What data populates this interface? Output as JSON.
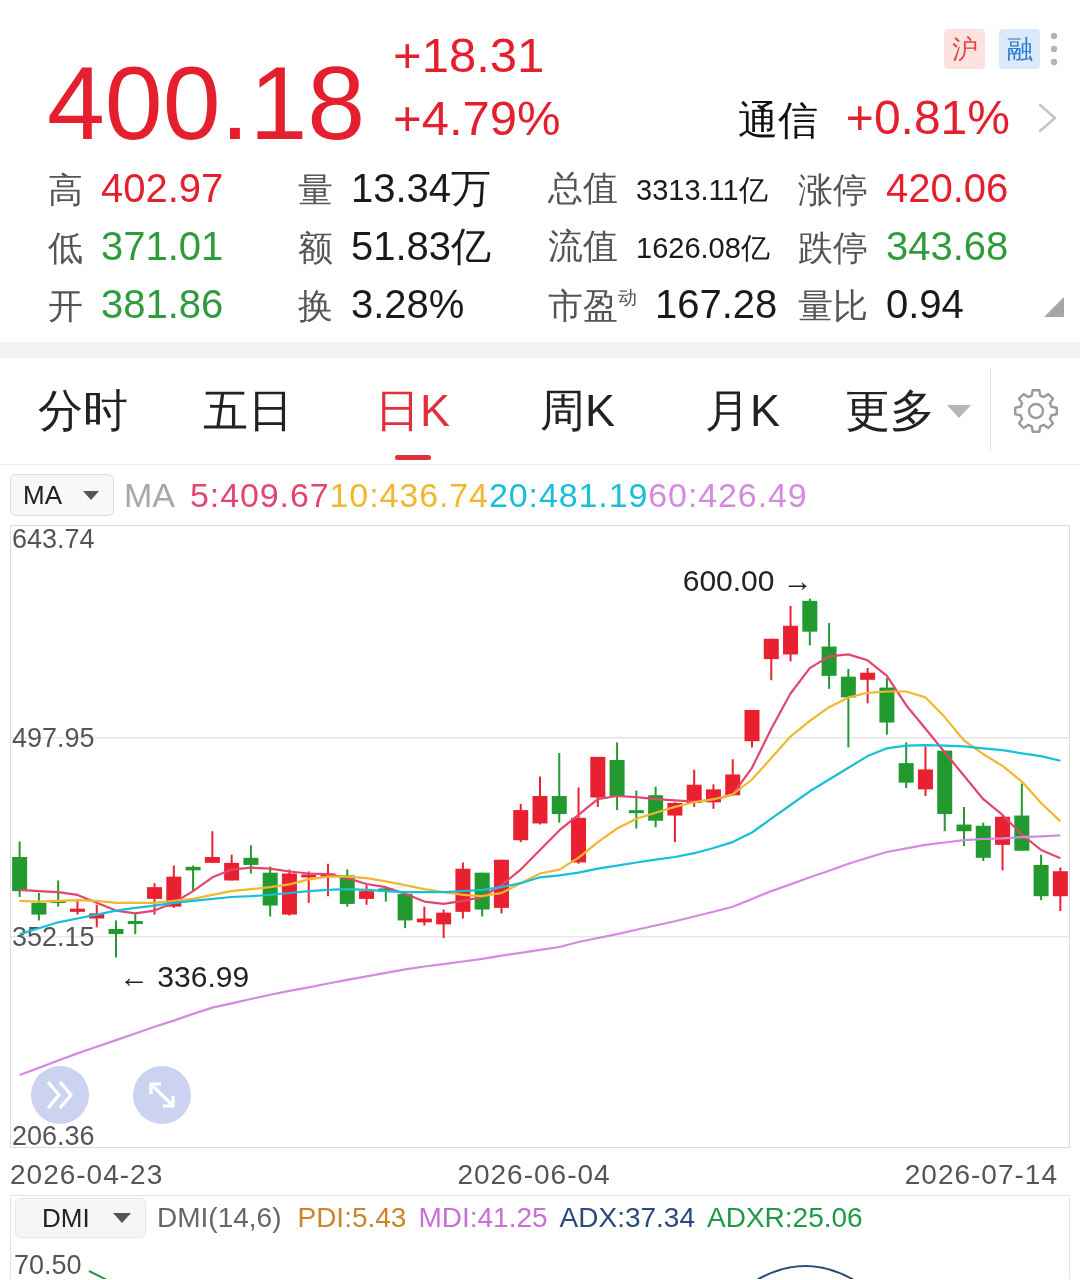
{
  "quote": {
    "price": "400.18",
    "change": "+18.31",
    "change_percent": "+4.79%",
    "color": "#e5202e"
  },
  "tags": [
    {
      "text": "沪",
      "kind": "exchange"
    },
    {
      "text": "融",
      "kind": "margin"
    }
  ],
  "sector": {
    "name": "通信",
    "change": "+0.81%",
    "color": "#e5202e"
  },
  "stats": [
    {
      "label": "高",
      "value": "402.97",
      "color": "#e5202e"
    },
    {
      "label": "量",
      "value": "13.34万",
      "color": "#1a1a1a"
    },
    {
      "label": "总值",
      "value": "3313.11亿",
      "color": "#1a1a1a"
    },
    {
      "label": "涨停",
      "value": "420.06",
      "color": "#e5202e"
    },
    {
      "label": "低",
      "value": "371.01",
      "color": "#2e9b3c"
    },
    {
      "label": "额",
      "value": "51.83亿",
      "color": "#1a1a1a"
    },
    {
      "label": "流值",
      "value": "1626.08亿",
      "color": "#1a1a1a"
    },
    {
      "label": "跌停",
      "value": "343.68",
      "color": "#2e9b3c"
    },
    {
      "label": "开",
      "value": "381.86",
      "color": "#2e9b3c"
    },
    {
      "label": "换",
      "value": "3.28%",
      "color": "#1a1a1a"
    },
    {
      "label": "市盈$^{动}$",
      "value": "167.28",
      "color": "#1a1a1a"
    },
    {
      "label": "量比",
      "value": "0.94",
      "color": "#1a1a1a"
    }
  ],
  "tabs": [
    {
      "label": "分时",
      "kind": "period",
      "selected": false
    },
    {
      "label": "五日",
      "kind": "period",
      "selected": false
    },
    {
      "label": "日K",
      "kind": "period",
      "selected": true
    },
    {
      "label": "周K",
      "kind": "period",
      "selected": false
    },
    {
      "label": "月K",
      "kind": "period",
      "selected": false
    },
    {
      "label": "更多",
      "kind": "menu",
      "selected": false
    }
  ],
  "indicator_bar": {
    "selector": "MA",
    "name": "MA",
    "values": [
      {
        "text": "5:409.67",
        "color": "#e2466e"
      },
      {
        "text": "10:436.74",
        "color": "#f0b72f"
      },
      {
        "text": "20:481.19",
        "color": "#17bfd8"
      },
      {
        "text": "60:426.49",
        "color": "#d48ae0"
      }
    ]
  },
  "price_chart": {
    "chart_data": {
      "type": "candlestick",
      "categories": [
        null,
        null,
        null,
        null,
        null,
        null,
        null,
        null,
        null,
        null,
        null,
        null,
        null,
        null,
        null,
        null,
        null,
        null,
        null,
        null,
        null,
        null,
        null,
        null,
        null,
        null,
        null,
        null,
        null,
        null,
        null,
        null,
        null,
        null,
        null,
        null,
        null,
        null,
        null,
        null,
        null,
        null,
        null,
        null,
        null,
        null,
        null,
        null,
        null,
        null,
        null,
        null,
        null,
        null,
        null
      ],
      "ylim": [
        198.0,
        654.0
      ],
      "yticks": [
        {
          "value": 352.15,
          "label": "352.15"
        },
        {
          "value": 206.36,
          "label": "206.36"
        }
      ],
      "ohlc": [
        [
          410.6,
          422.0,
          381.3,
          385.6
        ],
        [
          377.0,
          384.2,
          364.1,
          368.4
        ],
        [
          379.0,
          393.4,
          374.2,
          377.0
        ],
        [
          370.4,
          379.9,
          368.4,
          372.7
        ],
        [
          365.5,
          375.6,
          359.0,
          369.3
        ],
        [
          357.8,
          364.1,
          336.99,
          354.1
        ],
        [
          363.3,
          369.8,
          354.1,
          361.8
        ],
        [
          379.9,
          391.4,
          368.4,
          388.5
        ],
        [
          374.2,
          404.3,
          373.3,
          396.2
        ],
        [
          403.4,
          404.3,
          385.6,
          400.8
        ],
        [
          406.3,
          429.5,
          406.3,
          410.6
        ],
        [
          393.4,
          412.3,
          393.4,
          406.3
        ],
        [
          410.0,
          419.2,
          398.5,
          404.8
        ],
        [
          399.1,
          403.7,
          367.0,
          375.0
        ],
        [
          368.4,
          401.4,
          367.6,
          398.5
        ],
        [
          395.7,
          400.0,
          377.0,
          397.7
        ],
        [
          396.2,
          405.7,
          381.9,
          398.5
        ],
        [
          397.1,
          401.4,
          374.2,
          376.2
        ],
        [
          379.9,
          389.9,
          375.6,
          385.6
        ],
        [
          387.1,
          388.5,
          377.9,
          385.9
        ],
        [
          383.6,
          384.2,
          358.4,
          364.1
        ],
        [
          362.7,
          374.2,
          360.4,
          365.5
        ],
        [
          361.2,
          372.1,
          351.2,
          369.8
        ],
        [
          370.4,
          406.6,
          365.5,
          402.0
        ],
        [
          399.1,
          399.1,
          367.0,
          372.1
        ],
        [
          373.3,
          408.6,
          369.3,
          408.6
        ],
        [
          422.9,
          449.6,
          421.5,
          445.0
        ],
        [
          435.2,
          469.7,
          434.4,
          455.3
        ],
        [
          455.3,
          486.9,
          435.8,
          442.1
        ],
        [
          406.6,
          461.6,
          405.7,
          439.3
        ],
        [
          454.2,
          484.0,
          447.3,
          484.0
        ],
        [
          481.7,
          494.6,
          445.0,
          455.3
        ],
        [
          444.4,
          459.3,
          431.5,
          443.3
        ],
        [
          455.9,
          462.2,
          432.4,
          437.2
        ],
        [
          441.0,
          450.7,
          421.5,
          450.2
        ],
        [
          450.2,
          474.5,
          447.3,
          463.6
        ],
        [
          450.7,
          463.9,
          445.9,
          460.2
        ],
        [
          455.9,
          482.3,
          455.3,
          471.1
        ],
        [
          495.5,
          518.4,
          490.9,
          518.4
        ],
        [
          555.7,
          570.6,
          540.2,
          570.6
        ],
        [
          559.1,
          594.7,
          554.0,
          580.1
        ],
        [
          598.4,
          600.0,
          565.7,
          575.8
        ],
        [
          564.9,
          582.1,
          533.9,
          543.4
        ],
        [
          542.8,
          548.5,
          490.9,
          527.6
        ],
        [
          540.5,
          549.1,
          523.3,
          545.7
        ],
        [
          534.8,
          541.9,
          500.3,
          509.2
        ],
        [
          479.4,
          494.6,
          461.1,
          465.1
        ],
        [
          460.2,
          491.7,
          455.3,
          474.8
        ],
        [
          488.6,
          488.6,
          429.5,
          442.1
        ],
        [
          434.4,
          447.3,
          418.6,
          429.5
        ],
        [
          433.5,
          435.8,
          407.7,
          410.0
        ],
        [
          419.5,
          441.0,
          400.8,
          440.1
        ],
        [
          441.0,
          464.5,
          415.2,
          415.2
        ],
        [
          404.8,
          412.3,
          379.0,
          381.87
        ],
        [
          381.86,
          402.97,
          371.01,
          400.18
        ]
      ],
      "annotations": [
        "600.00 →",
        "← 336.99"
      ]
    },
    "date_labels": [
      "2026-04-23",
      "2026-06-04",
      "2026-07-14"
    ]
  },
  "moving_averages": {
    "chart_data": {
      "type": "line",
      "categories": [
        null,
        null,
        null,
        null,
        null,
        null,
        null,
        null,
        null,
        null,
        null,
        null,
        null,
        null,
        null,
        null,
        null,
        null,
        null,
        null,
        null,
        null,
        null,
        null,
        null,
        null,
        null,
        null,
        null,
        null,
        null,
        null,
        null,
        null,
        null,
        null,
        null,
        null,
        null,
        null,
        null,
        null,
        null,
        null,
        null,
        null,
        null,
        null,
        null,
        null,
        null,
        null,
        null,
        null,
        null
      ],
      "ylim": [
        198.0,
        654.0
      ],
      "yticks": [
        {
          "value": 643.74,
          "label": "643.74"
        },
        {
          "value": 497.95,
          "label": "497.95"
        }
      ],
      "series": [
        {
          "color": "#e2466e",
          "values": [
            386.5,
            385.6,
            384.8,
            382.8,
            377.0,
            371.3,
            369.3,
            371.3,
            377.0,
            385.6,
            395.7,
            401.4,
            402.8,
            402.0,
            400.0,
            398.5,
            398.0,
            395.1,
            390.8,
            388.5,
            383.6,
            377.9,
            376.2,
            378.5,
            381.3,
            389.9,
            401.4,
            415.7,
            430.1,
            441.5,
            453.0,
            455.3,
            454.5,
            453.0,
            452.2,
            451.3,
            452.4,
            456.5,
            476.0,
            504.6,
            530.5,
            549.1,
            557.7,
            559.1,
            554.8,
            543.4,
            521.9,
            504.6,
            487.4,
            470.2,
            453.0,
            441.5,
            427.2,
            415.7,
            409.67
          ]
        },
        {
          "color": "#f0b72f",
          "values": [
            378.5,
            377.9,
            378.5,
            379.0,
            378.5,
            377.0,
            377.0,
            377.0,
            378.5,
            379.9,
            382.8,
            385.6,
            387.1,
            388.5,
            390.5,
            394.2,
            396.2,
            396.2,
            395.1,
            392.8,
            389.9,
            387.1,
            384.8,
            382.8,
            381.9,
            384.2,
            391.4,
            398.5,
            401.4,
            410.0,
            421.5,
            431.5,
            438.7,
            443.0,
            447.3,
            450.7,
            453.0,
            456.5,
            467.4,
            483.1,
            498.9,
            510.4,
            520.4,
            527.6,
            531.0,
            531.9,
            531.9,
            527.6,
            513.2,
            496.0,
            486.0,
            477.4,
            465.9,
            450.2,
            436.74
          ]
        },
        {
          "color": "#17bfd8",
          "values": [
            354.1,
            358.4,
            362.7,
            365.5,
            368.4,
            371.3,
            373.3,
            375.0,
            377.0,
            378.5,
            379.9,
            381.3,
            381.9,
            382.8,
            384.2,
            385.6,
            386.5,
            387.1,
            386.5,
            385.6,
            384.8,
            384.8,
            384.8,
            385.6,
            386.5,
            388.5,
            391.4,
            395.7,
            397.1,
            399.1,
            402.0,
            404.3,
            406.6,
            408.6,
            410.6,
            413.4,
            417.2,
            421.5,
            428.6,
            438.7,
            448.7,
            458.8,
            467.4,
            476.0,
            484.6,
            490.3,
            492.3,
            492.6,
            492.3,
            491.7,
            490.3,
            488.9,
            486.6,
            484.6,
            481.19
          ]
        },
        {
          "color": "#d48ae0",
          "values": [
            250.8,
            256.0,
            261.4,
            266.6,
            271.5,
            276.4,
            281.2,
            286.1,
            290.7,
            295.6,
            300.2,
            303.3,
            306.5,
            309.6,
            312.5,
            315.1,
            317.9,
            320.5,
            323.1,
            325.7,
            328.3,
            330.3,
            332.0,
            334.0,
            336.0,
            338.3,
            340.3,
            342.6,
            344.6,
            348.3,
            351.2,
            354.1,
            357.2,
            360.4,
            363.5,
            367.0,
            370.4,
            374.2,
            379.9,
            385.6,
            390.5,
            395.7,
            400.5,
            405.7,
            410.0,
            414.3,
            416.9,
            419.5,
            421.2,
            422.9,
            423.8,
            424.3,
            425.2,
            425.8,
            426.49
          ]
        }
      ]
    }
  },
  "dmi_panel": {
    "selector": "DMI",
    "name": "DMI(14,6)",
    "values": [
      {
        "text": "PDI:5.43",
        "color": "#c98528"
      },
      {
        "text": "MDI:41.25",
        "color": "#c86fd8"
      },
      {
        "text": "ADX:37.34",
        "color": "#2b4a7c"
      },
      {
        "text": "ADXR:25.06",
        "color": "#1e9a45"
      }
    ],
    "axis_label": "70.50"
  }
}
